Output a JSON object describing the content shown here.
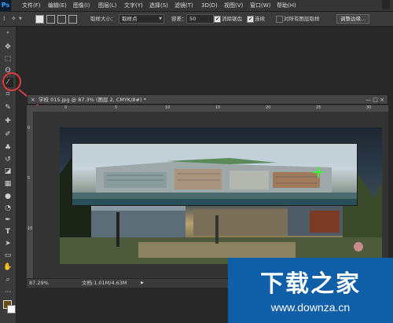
{
  "app": {
    "logo": "Ps"
  },
  "menubar": {
    "items": [
      "文件(F)",
      "编辑(E)",
      "图像(I)",
      "图层(L)",
      "文字(Y)",
      "选择(S)",
      "滤镜(T)",
      "3D(D)",
      "视图(V)",
      "窗口(W)",
      "帮助(H)"
    ]
  },
  "options": {
    "sample_size_label": "取样大小：",
    "sample_size_value": "取样点",
    "tolerance_label": "容差：",
    "tolerance_value": "50",
    "antialias_label": "消除锯齿",
    "antialias_checked": "✔",
    "contiguous_label": "连续",
    "contiguous_checked": "✔",
    "sample_all_label": "对所有图层取样",
    "refine_edge_button": "调整边缘..."
  },
  "document": {
    "tab_title": "学校 015.jpg @ 87.3% (图层 2, CMYK/8#) *",
    "close_glyph": "×",
    "window_buttons": "— □ ×",
    "ruler_top_labels": [
      "0",
      "5",
      "10",
      "15",
      "20",
      "25",
      "30"
    ],
    "ruler_left_labels": [
      "0",
      "5",
      "10"
    ],
    "zoom": "87.29%",
    "doc_info": "文档:1.01M/4.63M"
  },
  "toolbar": {
    "tools": [
      "move-icon",
      "marquee-icon",
      "lasso-icon",
      "magic-wand-icon",
      "crop-icon",
      "eyedropper-icon",
      "healing-icon",
      "brush-icon",
      "stamp-icon",
      "history-brush-icon",
      "eraser-icon",
      "gradient-icon",
      "blur-icon",
      "dodge-icon",
      "pen-icon",
      "type-icon",
      "path-select-icon",
      "shape-icon",
      "hand-icon",
      "zoom-icon"
    ],
    "selected_tool": "magic-wand-icon",
    "foreground_color": "#6b4a12",
    "background_color": "#ffffff"
  },
  "watermark": {
    "title": "下载之家",
    "url": "www.downza.cn"
  },
  "colors": {
    "highlight": "#e23b3b",
    "watermark_bg": "#0e5ea8"
  }
}
